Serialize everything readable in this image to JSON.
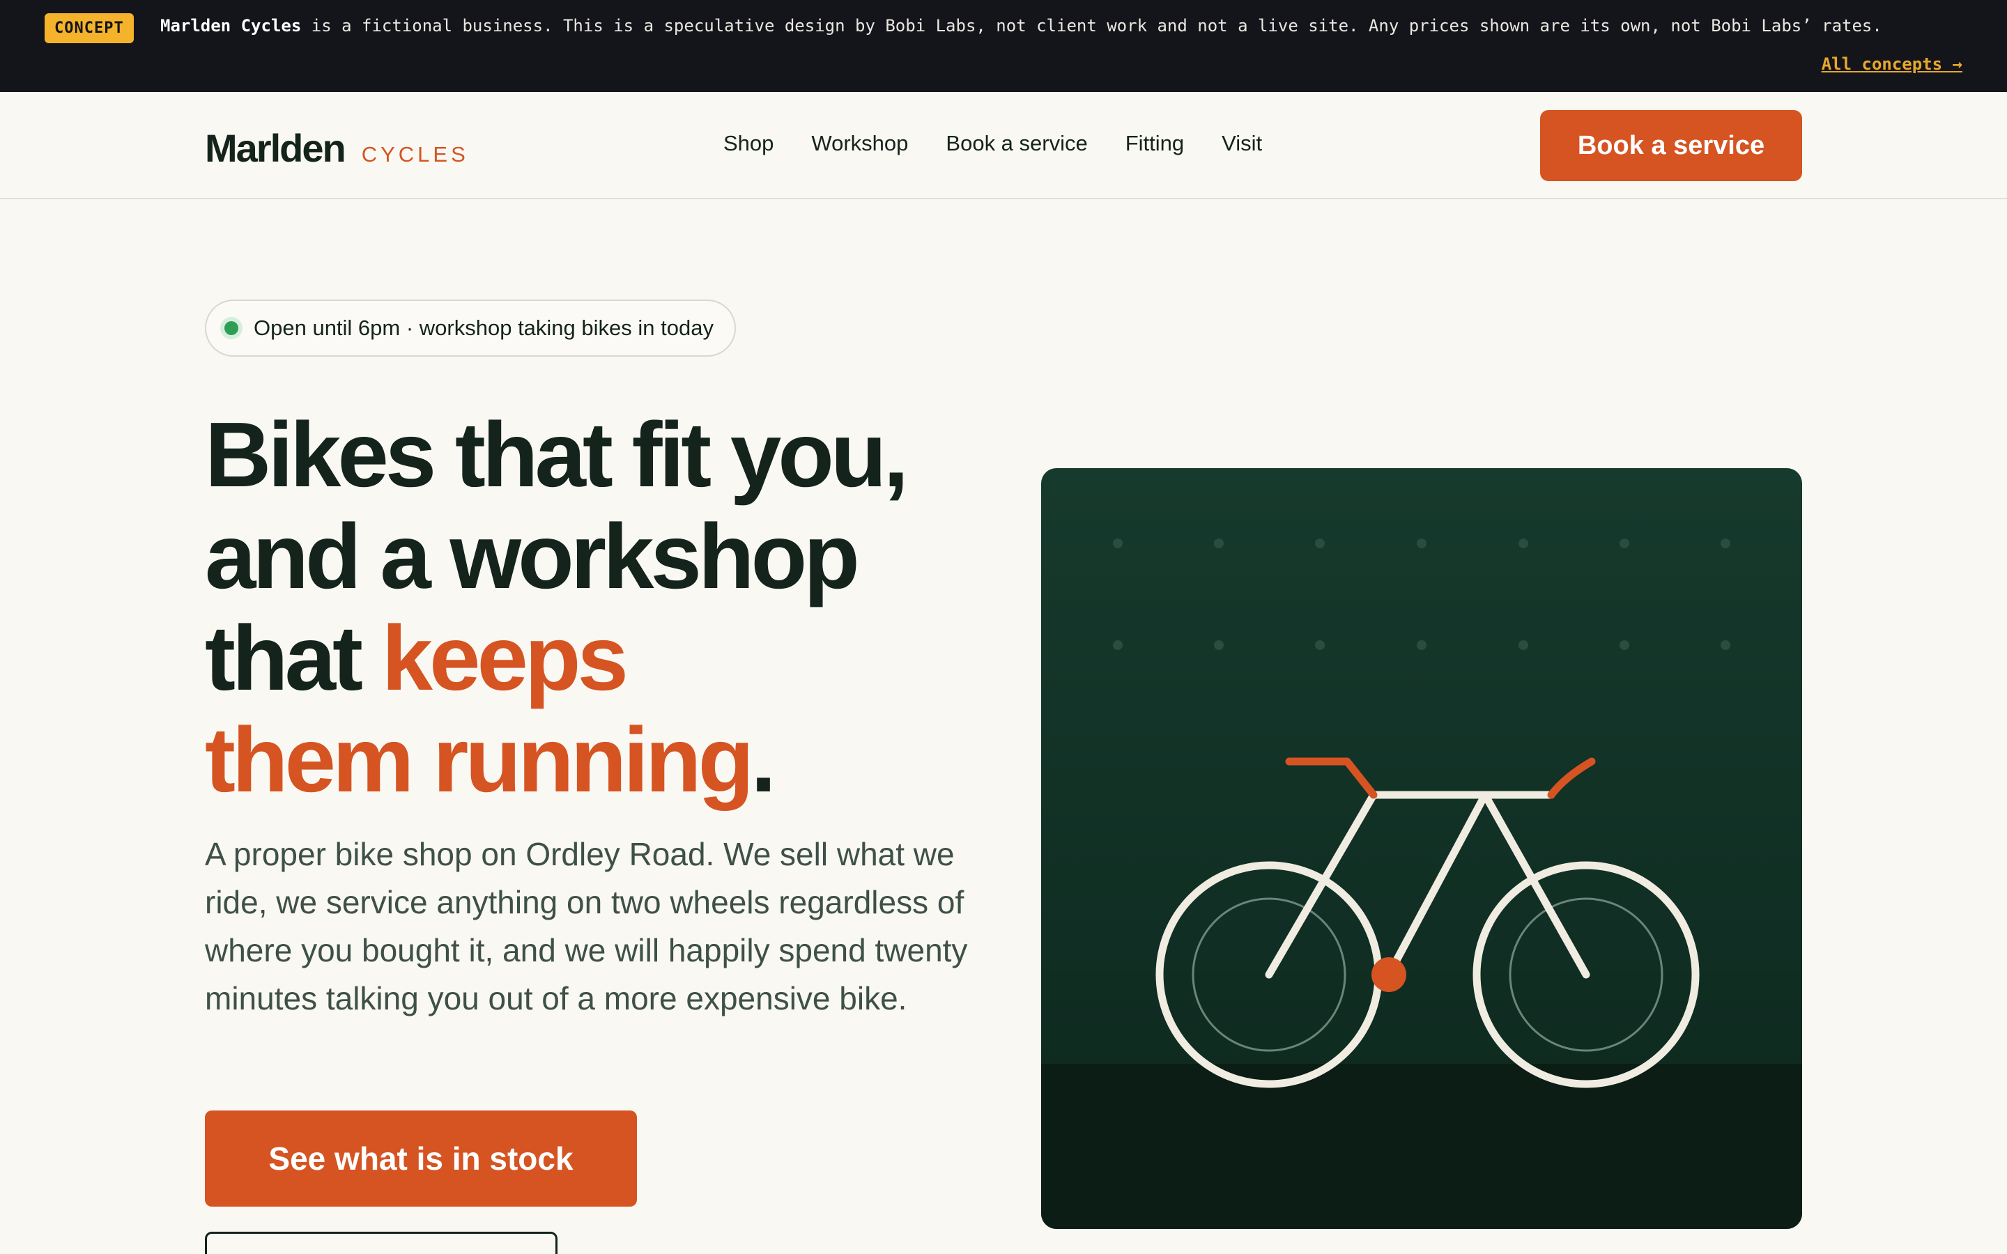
{
  "concept_bar": {
    "badge": "CONCEPT",
    "business_name": "Marlden Cycles",
    "disclaimer": " is a fictional business. This is a speculative design by Bobi Labs, not client work and not a live site. Any prices shown are its own, not Bobi Labs’ rates.",
    "link": "All concepts →"
  },
  "header": {
    "logo_main": "Marlden",
    "logo_sub": "CYCLES",
    "nav": [
      "Shop",
      "Workshop",
      "Book a service",
      "Fitting",
      "Visit"
    ],
    "cta": "Book a service"
  },
  "hero": {
    "status": "Open until 6pm · workshop taking bikes in today",
    "title_line1": "Bikes that fit you,",
    "title_line2": "and a workshop",
    "title_line3_plain": "that ",
    "title_line3_accent": "keeps",
    "title_line4_accent": "them running",
    "title_end": ".",
    "body": "A proper bike shop on Ordley Road. We sell what we ride, we service anything on two wheels regardless of where you bought it, and we will happily spend twenty minutes talking you out of a more expensive bike.",
    "cta_primary": "See what is in stock",
    "cta_secondary": ""
  },
  "colors": {
    "accent": "#d55422",
    "ink": "#14241c",
    "art_bg": "#163a2d",
    "concept_badge": "#f4b32a",
    "status_open": "#2f9e55"
  }
}
